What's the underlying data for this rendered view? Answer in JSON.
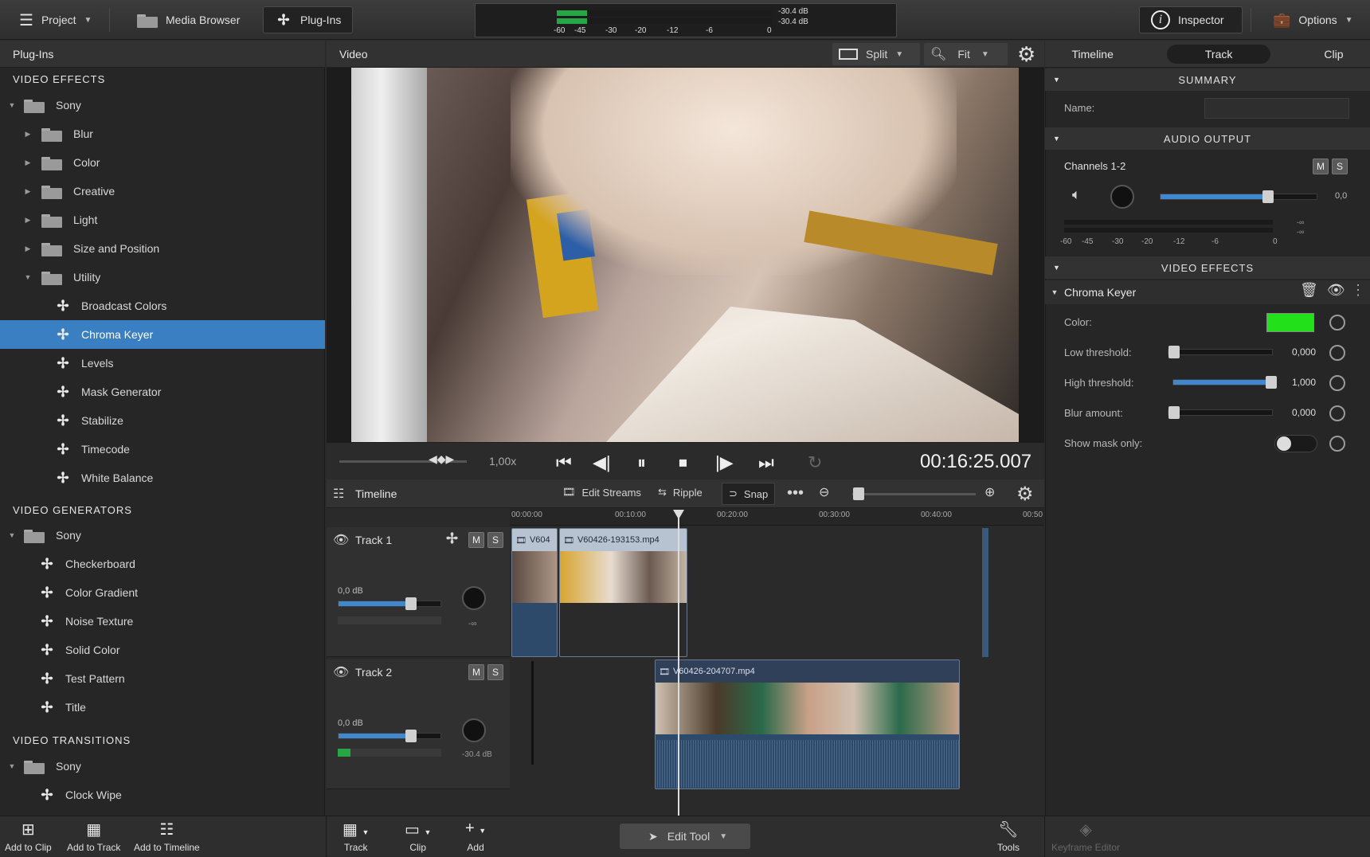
{
  "topbar": {
    "project": "Project",
    "media_browser": "Media Browser",
    "plugins": "Plug-Ins",
    "inspector": "Inspector",
    "options": "Options",
    "meter_top": "-30.4 dB",
    "meter_bottom": "-30.4 dB",
    "meter_scale": [
      "-60",
      "-45",
      "-30",
      "-20",
      "-12",
      "-6",
      "0"
    ]
  },
  "left": {
    "title": "Plug-Ins",
    "video_effects": "VIDEO EFFECTS",
    "sony1": "Sony",
    "folders": [
      "Blur",
      "Color",
      "Creative",
      "Light",
      "Size and Position",
      "Utility"
    ],
    "utility_items": [
      "Broadcast Colors",
      "Chroma Keyer",
      "Levels",
      "Mask Generator",
      "Stabilize",
      "Timecode",
      "White Balance"
    ],
    "video_generators": "VIDEO GENERATORS",
    "sony2": "Sony",
    "generator_items": [
      "Checkerboard",
      "Color Gradient",
      "Noise Texture",
      "Solid Color",
      "Test Pattern",
      "Title"
    ],
    "video_transitions": "VIDEO TRANSITIONS",
    "sony3": "Sony",
    "transition_items": [
      "Clock Wipe"
    ]
  },
  "video": {
    "title": "Video",
    "split": "Split",
    "fit": "Fit",
    "speed": "1,00x",
    "timecode": "00:16:25.007"
  },
  "timeline": {
    "title": "Timeline",
    "edit_streams": "Edit Streams",
    "ripple": "Ripple",
    "snap": "Snap",
    "ruler": [
      "00:00:00",
      "00:10:00",
      "00:20:00",
      "00:30:00",
      "00:40:00",
      "00:50"
    ],
    "track1": {
      "name": "Track 1",
      "gain": "0,0 dB",
      "pan_label": "-∞",
      "m": "M",
      "s": "S"
    },
    "track2": {
      "name": "Track 2",
      "gain": "0,0 dB",
      "level": "-30.4 dB",
      "m": "M",
      "s": "S"
    },
    "clip_a": "V604",
    "clip_b": "V60426-193153.mp4",
    "clip_c": "V60426-204707.mp4"
  },
  "inspector": {
    "tabs": [
      "Timeline",
      "Track",
      "Clip"
    ],
    "summary": "SUMMARY",
    "name_label": "Name:",
    "audio_output": "AUDIO OUTPUT",
    "channels": "Channels 1-2",
    "m": "M",
    "s": "S",
    "volume_value": "0,0",
    "scale": [
      "-60",
      "-45",
      "-30",
      "-20",
      "-12",
      "-6",
      "0"
    ],
    "neg_inf": "-∞",
    "video_effects": "VIDEO EFFECTS",
    "effect_name": "Chroma Keyer",
    "color_label": "Color:",
    "key_color": "#22e01a",
    "low_label": "Low threshold:",
    "low_value": "0,000",
    "high_label": "High threshold:",
    "high_value": "1,000",
    "blur_label": "Blur amount:",
    "blur_value": "0,000",
    "mask_label": "Show mask only:"
  },
  "bottom": {
    "add_to_clip": "Add to Clip",
    "add_to_track": "Add to Track",
    "add_to_timeline": "Add to Timeline",
    "track": "Track",
    "clip": "Clip",
    "add": "Add",
    "edit_tool": "Edit Tool",
    "tools": "Tools",
    "keyframe_editor": "Keyframe Editor"
  }
}
